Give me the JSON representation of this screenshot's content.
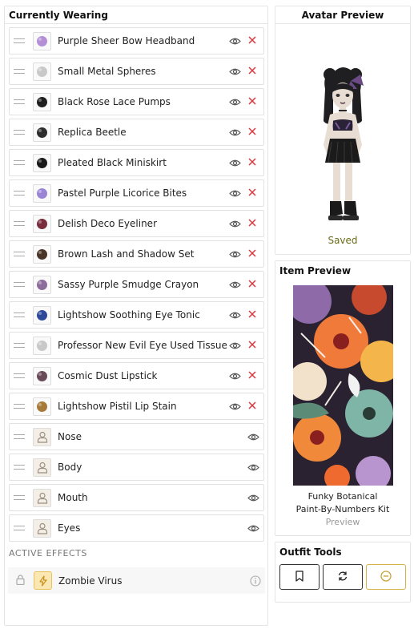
{
  "left": {
    "title": "Currently Wearing",
    "items": [
      {
        "name": "Purple Sheer Bow Headband",
        "icon": "bow-headband-icon",
        "color": "#b48fd6",
        "removable": true
      },
      {
        "name": "Small Metal Spheres",
        "icon": "metal-spheres-icon",
        "color": "#c9c9c9",
        "removable": true
      },
      {
        "name": "Black Rose Lace Pumps",
        "icon": "pumps-icon",
        "color": "#1e1e1e",
        "removable": true
      },
      {
        "name": "Replica Beetle",
        "icon": "beetle-icon",
        "color": "#2c2c2c",
        "removable": true
      },
      {
        "name": "Pleated Black Miniskirt",
        "icon": "miniskirt-icon",
        "color": "#1a1a1a",
        "removable": true
      },
      {
        "name": "Pastel Purple Licorice Bites",
        "icon": "licorice-jar-icon",
        "color": "#9a85d4",
        "removable": true
      },
      {
        "name": "Delish Deco Eyeliner",
        "icon": "eyeliner-icon",
        "color": "#7a2d3c",
        "removable": true
      },
      {
        "name": "Brown Lash and Shadow Set",
        "icon": "makeup-palette-icon",
        "color": "#4a3428",
        "removable": true
      },
      {
        "name": "Sassy Purple Smudge Crayon",
        "icon": "crayon-icon",
        "color": "#8d6d9b",
        "removable": true
      },
      {
        "name": "Lightshow Soothing Eye Tonic",
        "icon": "tonic-bottle-icon",
        "color": "#2d4a9a",
        "removable": true
      },
      {
        "name": "Professor New Evil Eye Used Tissue",
        "icon": "tissue-icon",
        "color": "#c8c8c8",
        "removable": true
      },
      {
        "name": "Cosmic Dust Lipstick",
        "icon": "lipstick-icon",
        "color": "#6a4b5a",
        "removable": true
      },
      {
        "name": "Lightshow Pistil Lip Stain",
        "icon": "lip-stain-icon",
        "color": "#a67a38",
        "removable": true
      },
      {
        "name": "Nose",
        "icon": "person-icon",
        "color": "#9a8f80",
        "removable": false
      },
      {
        "name": "Body",
        "icon": "person-icon",
        "color": "#9a8f80",
        "removable": false
      },
      {
        "name": "Mouth",
        "icon": "person-icon",
        "color": "#9a8f80",
        "removable": false
      },
      {
        "name": "Eyes",
        "icon": "person-icon",
        "color": "#9a8f80",
        "removable": false
      }
    ],
    "effects_title": "ACTIVE EFFECTS",
    "effect": {
      "name": "Zombie Virus",
      "icon": "lightning-icon"
    }
  },
  "avatar": {
    "title": "Avatar Preview",
    "status": "Saved"
  },
  "item_preview": {
    "title": "Item Preview",
    "name_line1": "Funky Botanical",
    "name_line2": "Paint-By-Numbers Kit",
    "sub": "Preview"
  },
  "tools": {
    "title": "Outfit Tools",
    "buttons": [
      "bookmark-icon",
      "refresh-icon",
      "minus-circle-icon"
    ]
  },
  "colors": {
    "remove": "#d9363e",
    "accent": "#d6b24a",
    "saved": "#6b6b1a"
  }
}
